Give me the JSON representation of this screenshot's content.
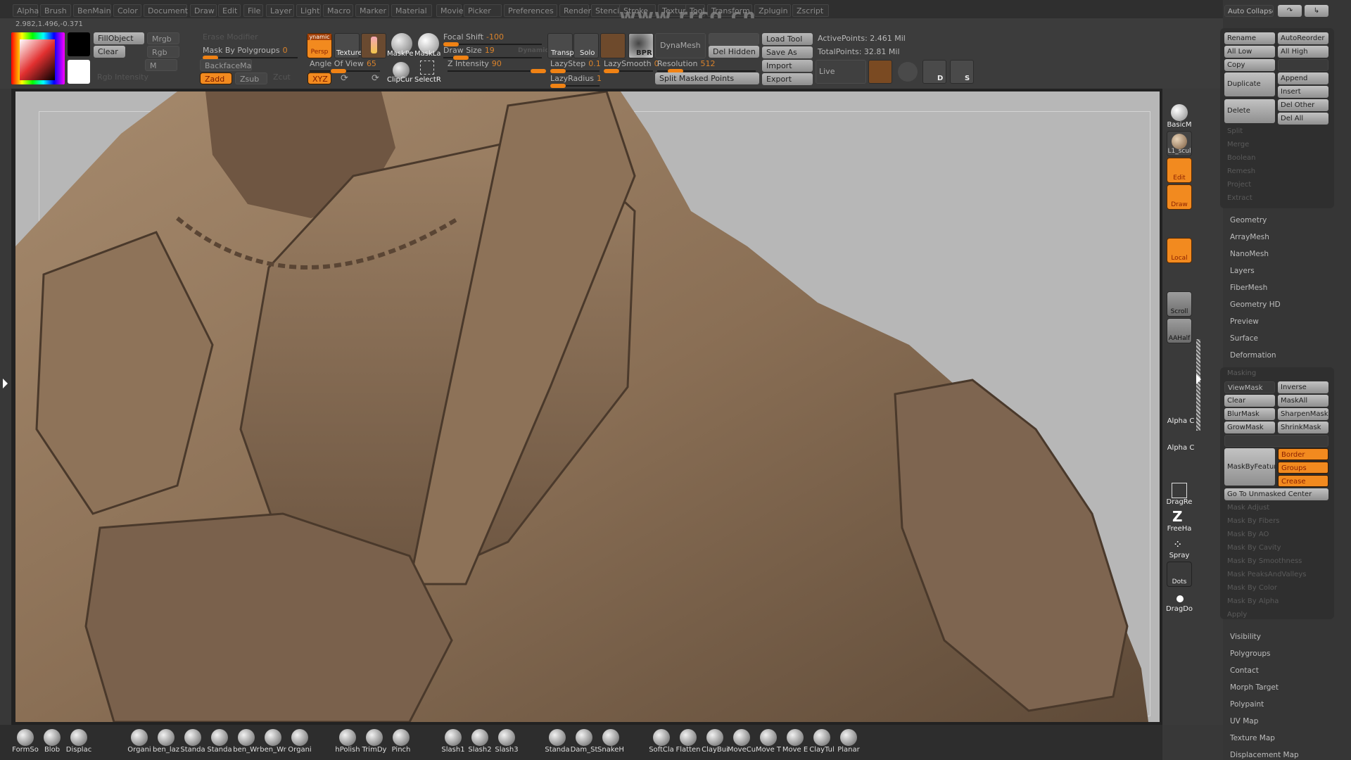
{
  "watermark": "www.rrcg.cn",
  "menu": [
    "Alpha",
    "Brush",
    "BenMain",
    "Color",
    "Document",
    "Draw",
    "Edit",
    "File",
    "Layer",
    "Light",
    "Macro",
    "Marker",
    "Material",
    "Movie",
    "Picker",
    "Preferences",
    "Render",
    "Stencil",
    "Stroke",
    "Texture",
    "Tool",
    "Transform",
    "Zplugin",
    "Zscript"
  ],
  "coords": "2.982,1.496,-0.371",
  "top": {
    "fill_object": "FillObject",
    "clear": "Clear",
    "mrgb": "Mrgb",
    "rgb": "Rgb",
    "m": "M",
    "rgb_intensity": "Rgb Intensity",
    "erase_mode": "Erase Modifier",
    "mask_by_polygroups": {
      "label": "Mask By Polygroups",
      "value": "0"
    },
    "backface_mask": "BackfaceMask",
    "zadd": "Zadd",
    "zsub": "Zsub",
    "zcut": "Zcut",
    "persp": "Persp",
    "dynamic": "ynamic",
    "texture": "Texture",
    "angle_of_view": {
      "label": "Angle Of View",
      "value": "65"
    },
    "xyz": "XYZ",
    "mask_pen": "MaskPe",
    "mask_lasso": "MaskLa",
    "clip_curve": "ClipCur",
    "select_rect": "SelectR",
    "focal_shift": {
      "label": "Focal Shift",
      "value": "-100"
    },
    "draw_size": {
      "label": "Draw Size",
      "value": "19"
    },
    "z_intensity": {
      "label": "Z Intensity",
      "value": "90"
    },
    "dynamic_label": "Dynamic",
    "transp": "Transp",
    "solo": "Solo",
    "bpr": "BPR",
    "lazy_step": {
      "label": "LazyStep",
      "value": "0.1"
    },
    "lazy_smooth": {
      "label": "LazySmooth",
      "value": "0"
    },
    "lazy_radius": {
      "label": "LazyRadius",
      "value": "1"
    },
    "dynamesh": "DynaMesh",
    "resolution": {
      "label": "Resolution",
      "value": "512"
    },
    "del_hidden": "Del Hidden",
    "split_masked": "Split Masked Points",
    "load_tool": "Load Tool",
    "save_as": "Save As",
    "import": "Import",
    "export": "Export",
    "active_points": "ActivePoints: 2.461 Mil",
    "total_points": "TotalPoints: 32.81 Mil",
    "live_boolean": "Live Boolean",
    "d_label": "D",
    "s_label": "S"
  },
  "tray": {
    "basic_material": "BasicM",
    "l1_sculpt": "L1_scul",
    "edit": "Edit",
    "draw": "Draw",
    "local": "Local",
    "scroll": "Scroll",
    "aahalf": "AAHalf",
    "alpha1": "Alpha C",
    "alpha2": "Alpha C",
    "drag_rect": "DragRe",
    "freehand": "FreeHa",
    "spray": "Spray",
    "dots": "Dots",
    "drag_dot": "DragDo"
  },
  "palette": {
    "auto_collapse": "Auto Collapse",
    "subtool_buttons": {
      "rename": "Rename",
      "auto_reorder": "AutoReorder",
      "all_low": "All Low",
      "all_high": "All High",
      "copy": "Copy",
      "duplicate": "Duplicate",
      "append": "Append",
      "insert": "Insert",
      "delete": "Delete",
      "del_other": "Del Other",
      "del_all": "Del All"
    },
    "subtool_disabled": [
      "Split",
      "Merge",
      "Boolean",
      "Remesh",
      "Project",
      "Extract"
    ],
    "sections_a": [
      "Geometry",
      "ArrayMesh",
      "NanoMesh",
      "Layers",
      "FiberMesh",
      "Geometry HD",
      "Preview",
      "Surface",
      "Deformation"
    ],
    "masking": {
      "title": "Masking",
      "view_mask": "ViewMask",
      "inverse": "Inverse",
      "clear": "Clear",
      "mask_all": "MaskAll",
      "blur_mask": "BlurMask",
      "sharpen_mask": "SharpenMask",
      "grow_mask": "GrowMask",
      "shrink_mask": "ShrinkMask",
      "mask_by_feature": "MaskByFeature",
      "border": "Border",
      "groups": "Groups",
      "crease": "Crease",
      "go_to_unmasked": "Go To Unmasked Center",
      "disabled": [
        "Mask Adjust",
        "Mask By Fibers",
        "Mask By AO",
        "Mask By Cavity",
        "Mask By Smoothness",
        "Mask PeaksAndValleys",
        "Mask By Color",
        "Mask By Alpha",
        "Apply"
      ]
    },
    "sections_b": [
      "Visibility",
      "Polygroups",
      "Contact",
      "Morph Target",
      "Polypaint",
      "UV Map",
      "Texture Map",
      "Displacement Map"
    ]
  },
  "brushes": [
    {
      "label": "FormSo"
    },
    {
      "label": "Blob"
    },
    {
      "label": "Displac"
    },
    {
      "label": "Organi"
    },
    {
      "label": "ben_laz"
    },
    {
      "label": "Standa"
    },
    {
      "label": "Standa"
    },
    {
      "label": "ben_Wr"
    },
    {
      "label": "ben_Wr"
    },
    {
      "label": "Organi"
    },
    {
      "label": "hPolish"
    },
    {
      "label": "TrimDy"
    },
    {
      "label": "Pinch"
    },
    {
      "label": "Slash1"
    },
    {
      "label": "Slash2"
    },
    {
      "label": "Slash3"
    },
    {
      "label": "Standa"
    },
    {
      "label": "Dam_St"
    },
    {
      "label": "SnakeH"
    },
    {
      "label": "SoftCla"
    },
    {
      "label": "Flatten"
    },
    {
      "label": "ClayBui"
    },
    {
      "label": "MoveCu"
    },
    {
      "label": "Move T"
    },
    {
      "label": "Move E"
    },
    {
      "label": "ClayTul"
    },
    {
      "label": "Planar"
    }
  ],
  "colors": {
    "accent": "#f28a1f",
    "viewport_bg": "#b7b7b7",
    "model": "#8b7159"
  }
}
